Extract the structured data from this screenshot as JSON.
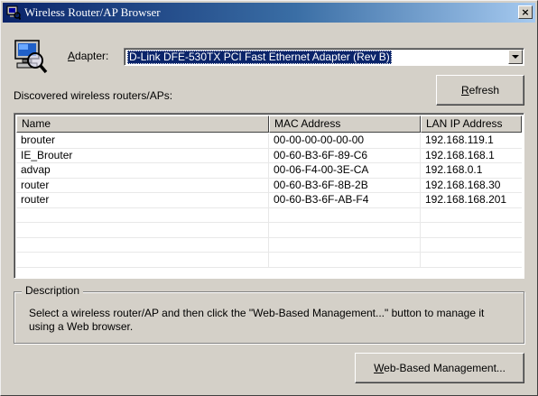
{
  "window": {
    "title": "Wireless Router/AP Browser",
    "close_glyph": "×"
  },
  "adapter": {
    "label_prefix": "",
    "label_accel": "A",
    "label_rest": "dapter:",
    "selected": "D-Link DFE-530TX PCI Fast Ethernet Adapter (Rev B)"
  },
  "discovered_label": "Discovered wireless routers/APs:",
  "refresh_button": {
    "accel": "R",
    "rest": "efresh"
  },
  "table": {
    "columns": [
      "Name",
      "MAC Address",
      "LAN IP Address"
    ],
    "rows": [
      [
        "brouter",
        "00-00-00-00-00-00",
        "192.168.119.1"
      ],
      [
        "IE_Brouter",
        "00-60-B3-6F-89-C6",
        "192.168.168.1"
      ],
      [
        "advap",
        "00-06-F4-00-3E-CA",
        "192.168.0.1"
      ],
      [
        "router",
        "00-60-B3-6F-8B-2B",
        "192.168.168.30"
      ],
      [
        "router",
        "00-60-B3-6F-AB-F4",
        "192.168.168.201"
      ],
      [
        "",
        "",
        ""
      ],
      [
        "",
        "",
        ""
      ],
      [
        "",
        "",
        ""
      ],
      [
        "",
        "",
        ""
      ]
    ]
  },
  "description": {
    "title": "Description",
    "text": "Select a wireless router/AP and then click the \"Web-Based Management...\" button to manage it using a Web browser."
  },
  "web_button": {
    "accel": "W",
    "rest": "eb-Based Management..."
  },
  "colors": {
    "face": "#d4d0c8",
    "titlebar_start": "#0a246a",
    "titlebar_end": "#a6caf0",
    "selection": "#0a246a"
  }
}
